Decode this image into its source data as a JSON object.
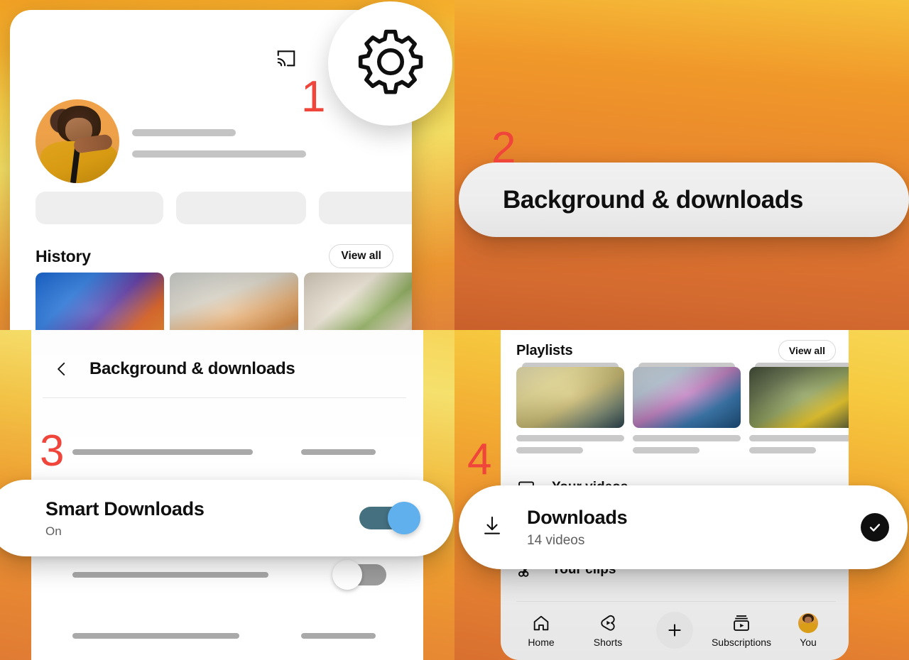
{
  "meta": {
    "app": "YouTube mobile app",
    "layout": "2x2 tutorial steps",
    "accent_red": "#f0453b",
    "toggle_on_track": "#45707f",
    "toggle_on_knob": "#5fb0ec",
    "toggle_off_track": "#9e9e9e",
    "background_gradient": [
      "#f6d65a",
      "#f0a024",
      "#d86f2f"
    ]
  },
  "steps": {
    "one": "1",
    "two": "2",
    "three": "3",
    "four": "4"
  },
  "panel1": {
    "icons": {
      "cast": "cast-icon",
      "bell": "bell-icon",
      "settings": "gear-icon"
    },
    "avatar_alt": "user-avatar",
    "section_title": "History",
    "view_all": "View all"
  },
  "panel2": {
    "callout_label": "Background & downloads"
  },
  "panel3": {
    "title": "Background & downloads",
    "back_icon": "back-chevron-icon",
    "callout": {
      "label": "Smart Downloads",
      "value": "On",
      "toggle_state": "on"
    },
    "secondary_toggle_state": "off"
  },
  "panel4": {
    "section_title": "Playlists",
    "view_all": "View all",
    "menu": [
      {
        "label": "Your videos",
        "icon": "video-play-icon"
      },
      {
        "label": "Your clips",
        "icon": "scissors-icon"
      }
    ],
    "callout": {
      "icon": "download-icon",
      "label": "Downloads",
      "subtitle": "14 videos",
      "badge": "check-icon"
    },
    "navbar": [
      {
        "label": "Home",
        "icon": "home-icon"
      },
      {
        "label": "Shorts",
        "icon": "shorts-icon"
      },
      {
        "label": "",
        "icon": "plus-icon"
      },
      {
        "label": "Subscriptions",
        "icon": "subscriptions-icon"
      },
      {
        "label": "You",
        "icon": "account-avatar-icon"
      }
    ]
  }
}
